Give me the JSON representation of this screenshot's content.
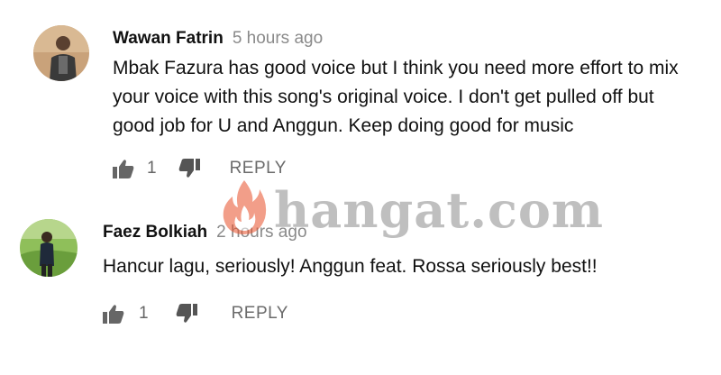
{
  "comments": [
    {
      "author": "Wawan Fatrin",
      "time": "5 hours ago",
      "lines": [
        "Mbak Fazura has good voice but I think you need more effort to mix",
        "your voice with this song's original voice. I don't get pulled off but",
        "good job for U and Anggun. Keep doing good for music"
      ],
      "like_count": "1",
      "reply_label": "REPLY",
      "like_icon": "thumbs-up-icon",
      "dislike_icon": "thumbs-down-icon"
    },
    {
      "author": "Faez Bolkiah",
      "time": "2 hours ago",
      "lines": [
        "Hancur lagu, seriously! Anggun feat. Rossa seriously best!!"
      ],
      "like_count": "1",
      "reply_label": "REPLY",
      "like_icon": "thumbs-up-icon",
      "dislike_icon": "thumbs-down-icon"
    }
  ],
  "watermark": {
    "text": "hangat.com",
    "icon": "flame-icon"
  },
  "colors": {
    "author": "#111111",
    "timestamp": "#8a8a8a",
    "action": "#6b6b6b",
    "watermark": "#8c8c8c",
    "flame": "#e8502a"
  }
}
